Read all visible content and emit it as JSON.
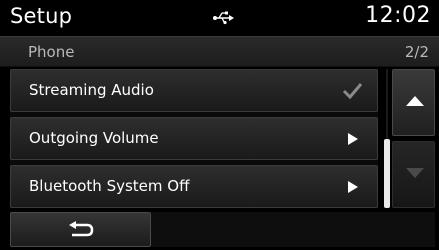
{
  "header": {
    "title": "Setup",
    "status_icon": "usb-icon",
    "time": "12:02"
  },
  "subheader": {
    "section": "Phone",
    "page": "2/2"
  },
  "list": {
    "items": [
      {
        "label": "Streaming Audio",
        "icon": "checkmark-icon",
        "checked": true
      },
      {
        "label": "Outgoing Volume",
        "icon": "arrow-right-icon"
      },
      {
        "label": "Bluetooth System Off",
        "icon": "arrow-right-icon"
      }
    ]
  },
  "scroll": {
    "up_icon": "triangle-up-icon",
    "down_icon": "triangle-down-icon",
    "position": "bottom"
  },
  "footer": {
    "back_icon": "back-arrow-icon"
  },
  "colors": {
    "background": "#000000",
    "item": "#262626",
    "text": "#ffffff",
    "subtext": "#b9b9b9"
  }
}
